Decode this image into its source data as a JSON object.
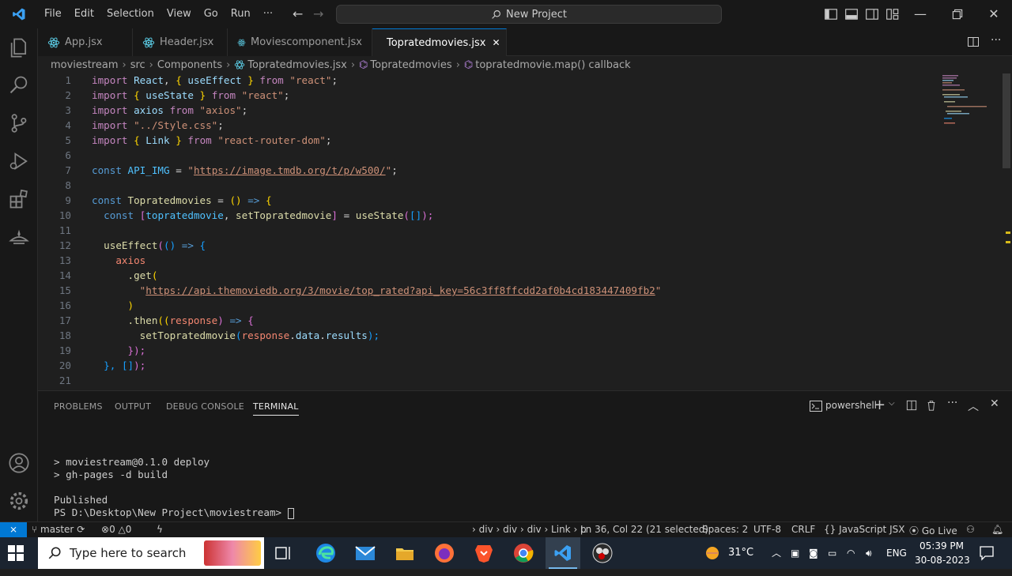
{
  "menu": [
    "File",
    "Edit",
    "Selection",
    "View",
    "Go",
    "Run",
    "···"
  ],
  "command_center": "New Project",
  "tabs": [
    {
      "label": "App.jsx",
      "active": false
    },
    {
      "label": "Header.jsx",
      "active": false
    },
    {
      "label": "Moviescomponent.jsx",
      "active": false
    },
    {
      "label": "Topratedmovies.jsx",
      "active": true
    }
  ],
  "breadcrumb": [
    "moviestream",
    "src",
    "Components",
    "Topratedmovies.jsx",
    "Topratedmovies",
    "topratedmovie.map() callback"
  ],
  "code_lines": [
    "1",
    "2",
    "3",
    "4",
    "5",
    "6",
    "7",
    "8",
    "9",
    "10",
    "11",
    "12",
    "13",
    "14",
    "15",
    "16",
    "17",
    "18",
    "19",
    "20",
    "21"
  ],
  "code": {
    "l1": [
      "import",
      "React",
      ",",
      "{",
      "useEffect",
      "}",
      "from",
      "\"react\"",
      ";"
    ],
    "l2": [
      "import",
      "{",
      "useState",
      "}",
      "from",
      "\"react\"",
      ";"
    ],
    "l3": [
      "import",
      "axios",
      "from",
      "\"axios\"",
      ";"
    ],
    "l4": [
      "import",
      "\"../Style.css\"",
      ";"
    ],
    "l5": [
      "import",
      "{",
      "Link",
      "}",
      "from",
      "\"react-router-dom\"",
      ";"
    ],
    "l7": [
      "const",
      "API_IMG",
      "=",
      "\"",
      "https://image.tmdb.org/t/p/w500/",
      "\"",
      ";"
    ],
    "l9": [
      "const",
      "Topratedmovies",
      "=",
      "()",
      "=>",
      "{"
    ],
    "l10": [
      "const",
      "[",
      "topratedmovie",
      ",",
      "setTopratedmovie",
      "]",
      "=",
      "useState",
      "(",
      "[]",
      ");"
    ],
    "l12": [
      "useEffect",
      "(",
      "()",
      "=>",
      "{"
    ],
    "l13": [
      "axios"
    ],
    "l14": [
      ".get",
      "("
    ],
    "l15": [
      "\"",
      "https://api.themoviedb.org/3/movie/top_rated?api_key=56c3ff8ffcdd2af0b4cd183447409fb2",
      "\""
    ],
    "l16": [
      ")"
    ],
    "l17": [
      ".then",
      "((",
      "response",
      ")",
      "=>",
      "{"
    ],
    "l18": [
      "setTopratedmovie",
      "(",
      "response",
      ".",
      "data",
      ".",
      "results",
      ");"
    ],
    "l19": [
      "});"
    ],
    "l20": [
      "},",
      "[]",
      ");"
    ]
  },
  "panel": {
    "tabs": [
      "PROBLEMS",
      "OUTPUT",
      "DEBUG CONSOLE",
      "TERMINAL"
    ],
    "active": "TERMINAL",
    "shell": "powershell",
    "terminal_lines": [
      "> moviestream@0.1.0 deploy",
      "> gh-pages -d build",
      "",
      "Published",
      "PS D:\\Desktop\\New Project\\moviestream> "
    ]
  },
  "statusbar": {
    "branch": "master",
    "errors": "0",
    "warnings": "0",
    "path": "› div › div › div › Link › p",
    "position": "Ln 36, Col 22 (21 selected)",
    "spaces": "Spaces: 2",
    "encoding": "UTF-8",
    "eol": "CRLF",
    "language": "JavaScript JSX",
    "golive": "Go Live"
  },
  "taskbar": {
    "search_placeholder": "Type here to search",
    "temperature": "31°C",
    "lang": "ENG",
    "time": "05:39 PM",
    "date": "30-08-2023"
  },
  "colors": {
    "accent": "#0078d4",
    "keyword": "#c586c0",
    "string": "#ce9178",
    "variable": "#9cdcfe",
    "function": "#dcdcaa"
  }
}
